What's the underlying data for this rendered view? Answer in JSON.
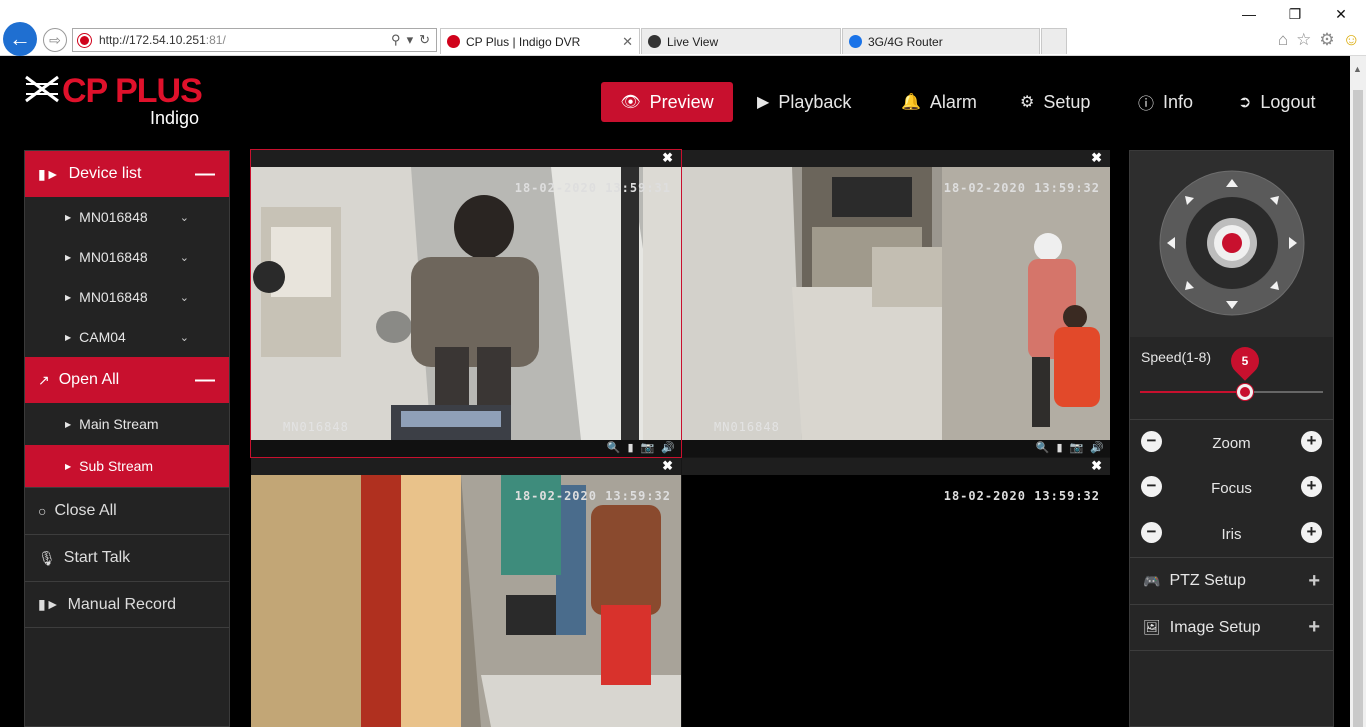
{
  "browser": {
    "url_main": "http://172.54.10.251",
    "url_port": ":81/",
    "tabs": [
      {
        "label": "CP Plus | Indigo DVR",
        "color": "#d0021b"
      },
      {
        "label": "Live View",
        "color": "#333333"
      },
      {
        "label": "3G/4G Router",
        "color": "#1a73e8"
      }
    ],
    "window_controls": [
      "—",
      "❐",
      "✕"
    ]
  },
  "app": {
    "brand": "CP PLUS",
    "brand_sub": "Indigo",
    "accent_color": "#c8102e",
    "nav": [
      {
        "label": "Preview",
        "icon": "eye-icon",
        "active": true
      },
      {
        "label": "Playback",
        "icon": "play-icon",
        "active": false
      },
      {
        "label": "Alarm",
        "icon": "bell-icon",
        "active": false
      },
      {
        "label": "Setup",
        "icon": "gear-icon",
        "active": false
      },
      {
        "label": "Info",
        "icon": "info-icon",
        "active": false
      },
      {
        "label": "Logout",
        "icon": "logout-icon",
        "active": false
      }
    ]
  },
  "sidebar": {
    "device_list_label": "Device list",
    "devices": [
      "MN016848",
      "MN016848",
      "MN016848",
      "CAM04"
    ],
    "open_all_label": "Open All",
    "streams": [
      {
        "label": "Main Stream",
        "active": false
      },
      {
        "label": "Sub Stream",
        "active": true
      }
    ],
    "close_all_label": "Close All",
    "start_talk_label": "Start Talk",
    "manual_record_label": "Manual Record"
  },
  "grid": {
    "cells": [
      {
        "timestamp": "18-02-2020 13:59:31",
        "camera": "MN016848",
        "selected": true
      },
      {
        "timestamp": "18-02-2020 13:59:32",
        "camera": "MN016848",
        "selected": false
      },
      {
        "timestamp": "18-02-2020 13:59:32",
        "camera": "",
        "selected": false
      },
      {
        "timestamp": "18-02-2020 13:59:32",
        "camera": "",
        "selected": false
      }
    ]
  },
  "ptz": {
    "speed_label": "Speed(1-8)",
    "speed_value": "5",
    "speed_min": 1,
    "speed_max": 8,
    "zoom_label": "Zoom",
    "focus_label": "Focus",
    "iris_label": "Iris",
    "ptz_setup_label": "PTZ Setup",
    "image_setup_label": "Image Setup"
  }
}
